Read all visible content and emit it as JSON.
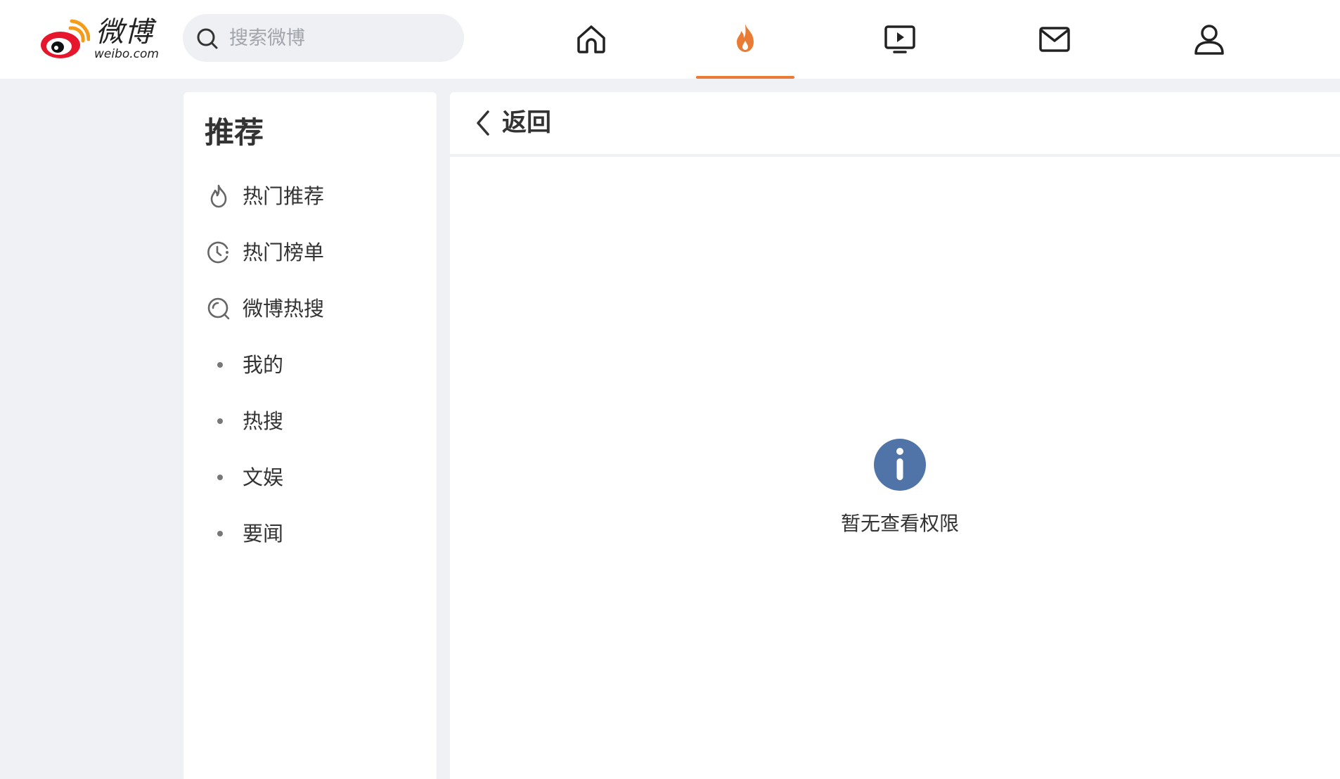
{
  "header": {
    "logo": {
      "wordmark": "微博",
      "domain": "weibo.com"
    },
    "search": {
      "placeholder": "搜索微博",
      "value": ""
    },
    "nav": [
      {
        "name": "home",
        "icon": "home-icon",
        "active": false
      },
      {
        "name": "hot",
        "icon": "flame-icon",
        "active": true
      },
      {
        "name": "video",
        "icon": "video-icon",
        "active": false
      },
      {
        "name": "messages",
        "icon": "mail-icon",
        "active": false
      },
      {
        "name": "profile",
        "icon": "user-icon",
        "active": false
      }
    ]
  },
  "sidebar": {
    "title": "推荐",
    "items": [
      {
        "label": "热门推荐",
        "icon": "flame-outline-icon"
      },
      {
        "label": "热门榜单",
        "icon": "clock-chart-icon"
      },
      {
        "label": "微博热搜",
        "icon": "search-circle-icon"
      },
      {
        "label": "我的",
        "icon": "bullet-dot"
      },
      {
        "label": "热搜",
        "icon": "bullet-dot"
      },
      {
        "label": "文娱",
        "icon": "bullet-dot"
      },
      {
        "label": "要闻",
        "icon": "bullet-dot"
      }
    ]
  },
  "main": {
    "back_label": "返回",
    "empty_state": {
      "icon": "info-icon",
      "message": "暂无查看权限"
    }
  },
  "colors": {
    "accent": "#ea7b34",
    "info": "#5073a8",
    "background": "#eff1f4",
    "panel": "#ffffff"
  }
}
